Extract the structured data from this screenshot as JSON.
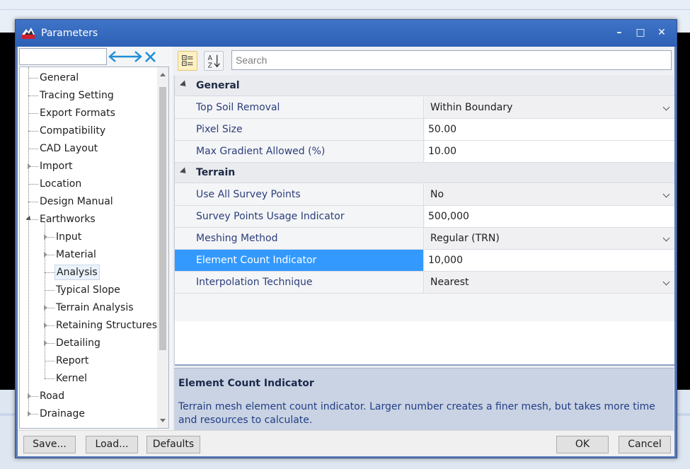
{
  "window": {
    "title": "Parameters",
    "controls": {
      "minimize": "–",
      "maximize": "□",
      "close": "✕"
    }
  },
  "tree": {
    "filter_value": "",
    "items": [
      {
        "label": "General",
        "level": 0,
        "expander": "none"
      },
      {
        "label": "Tracing Setting",
        "level": 0,
        "expander": "none"
      },
      {
        "label": "Export Formats",
        "level": 0,
        "expander": "none"
      },
      {
        "label": "Compatibility",
        "level": 0,
        "expander": "none"
      },
      {
        "label": "CAD Layout",
        "level": 0,
        "expander": "none"
      },
      {
        "label": "Import",
        "level": 0,
        "expander": "closed"
      },
      {
        "label": "Location",
        "level": 0,
        "expander": "none"
      },
      {
        "label": "Design Manual",
        "level": 0,
        "expander": "none"
      },
      {
        "label": "Earthworks",
        "level": 0,
        "expander": "open"
      },
      {
        "label": "Input",
        "level": 1,
        "expander": "closed"
      },
      {
        "label": "Material",
        "level": 1,
        "expander": "closed"
      },
      {
        "label": "Analysis",
        "level": 1,
        "expander": "none",
        "selected": true
      },
      {
        "label": "Typical Slope",
        "level": 1,
        "expander": "none"
      },
      {
        "label": "Terrain Analysis",
        "level": 1,
        "expander": "closed"
      },
      {
        "label": "Retaining Structures",
        "level": 1,
        "expander": "closed"
      },
      {
        "label": "Detailing",
        "level": 1,
        "expander": "closed"
      },
      {
        "label": "Report",
        "level": 1,
        "expander": "none"
      },
      {
        "label": "Kernel",
        "level": 1,
        "expander": "none"
      },
      {
        "label": "Road",
        "level": 0,
        "expander": "closed"
      },
      {
        "label": "Drainage",
        "level": 0,
        "expander": "closed"
      }
    ]
  },
  "property_grid": {
    "search_placeholder": "Search",
    "categories": [
      {
        "name": "General",
        "properties": [
          {
            "name": "Top Soil Removal",
            "value": "Within Boundary",
            "type": "dropdown"
          },
          {
            "name": "Pixel Size",
            "value": "50.00",
            "type": "text"
          },
          {
            "name": "Max Gradient Allowed (%)",
            "value": "10.00",
            "type": "text"
          }
        ]
      },
      {
        "name": "Terrain",
        "properties": [
          {
            "name": "Use All Survey Points",
            "value": "No",
            "type": "dropdown"
          },
          {
            "name": "Survey Points Usage Indicator",
            "value": "500,000",
            "type": "text"
          },
          {
            "name": "Meshing Method",
            "value": "Regular (TRN)",
            "type": "dropdown"
          },
          {
            "name": "Element Count Indicator",
            "value": "10,000",
            "type": "text",
            "selected": true
          },
          {
            "name": "Interpolation Technique",
            "value": "Nearest",
            "type": "dropdown"
          }
        ]
      }
    ]
  },
  "help": {
    "title": "Element Count Indicator",
    "description": "Terrain mesh element count indicator. Larger number creates a finer mesh, but takes more time and resources to calculate."
  },
  "footer": {
    "save": "Save...",
    "load": "Load...",
    "defaults": "Defaults",
    "ok": "OK",
    "cancel": "Cancel"
  },
  "colors": {
    "titlebar": "#2d60b6",
    "selection": "#3399ff",
    "help_panel": "#c9d3e3",
    "property_name_text": "#2c3e79"
  }
}
